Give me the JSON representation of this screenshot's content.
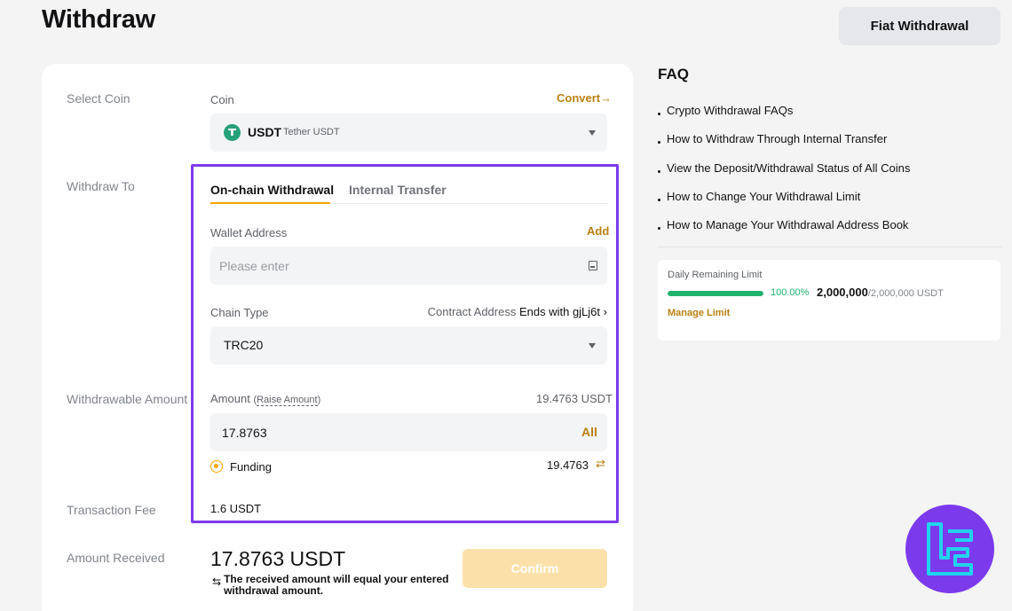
{
  "header": {
    "title": "Withdraw",
    "fiat_button": "Fiat Withdrawal"
  },
  "form": {
    "labels": {
      "select_coin": "Select Coin",
      "withdraw_to": "Withdraw To",
      "withdrawable_amount": "Withdrawable Amount",
      "transaction_fee": "Transaction Fee",
      "amount_received": "Amount Received"
    },
    "coin": {
      "label": "Coin",
      "convert_link": "Convert",
      "symbol": "USDT",
      "name": "Tether USDT",
      "icon": "tether-icon",
      "icon_color": "#26a17b"
    },
    "tabs": [
      {
        "label": "On-chain Withdrawal",
        "active": true
      },
      {
        "label": "Internal Transfer",
        "active": false
      }
    ],
    "wallet_address": {
      "label": "Wallet Address",
      "add_link": "Add",
      "placeholder": "Please enter",
      "value": "",
      "icon": "address-book-icon"
    },
    "chain": {
      "label": "Chain Type",
      "contract_prefix": "Contract Address",
      "contract_value": "Ends with gjLj6t",
      "contract_chevron": "›",
      "selected": "TRC20"
    },
    "amount": {
      "label": "Amount",
      "raise_open": "(",
      "raise_link": "Raise Amount",
      "raise_close": ")",
      "available": "19.4763 USDT",
      "value": "17.8763",
      "all_button": "All"
    },
    "funding": {
      "label": "Funding",
      "value": "19.4763",
      "icon": "swap-icon"
    },
    "fee": "1.6 USDT",
    "received": {
      "value": "17.8763 USDT",
      "note_line1": "The received amount will equal your entered",
      "note_line2": "withdrawal amount.",
      "note_icon": "exchange-arrows-icon"
    },
    "confirm_button": "Confirm"
  },
  "faq": {
    "title": "FAQ",
    "items": [
      "Crypto Withdrawal FAQs",
      "How to Withdraw Through Internal Transfer",
      "View the Deposit/Withdrawal Status of All Coins",
      "How to Change Your Withdrawal Limit",
      "How to Manage Your Withdrawal Address Book"
    ]
  },
  "limit": {
    "title": "Daily Remaining Limit",
    "progress_percent": 100,
    "percent_label": "100.00%",
    "remaining": "2,000,000",
    "total": "/2,000,000 USDT",
    "manage_link": "Manage Limit"
  },
  "colors": {
    "accent": "#f7a600",
    "link": "#b98011",
    "highlight_border": "#7c3aed",
    "success": "#20b26c"
  }
}
